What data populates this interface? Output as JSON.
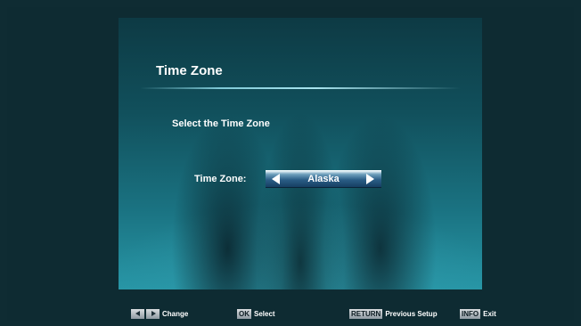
{
  "screen": {
    "title": "Time Zone",
    "instruction": "Select the Time Zone",
    "field_label": "Time Zone:",
    "selected_value": "Alaska"
  },
  "footer": {
    "change_label": "Change",
    "ok_key": "OK",
    "ok_label": "Select",
    "return_key": "RETURN",
    "return_label": "Previous Setup",
    "info_key": "INFO",
    "info_label": "Exit"
  },
  "colors": {
    "panel_top": "#0d3a44",
    "panel_bottom": "#2796a6",
    "selector_blue": "#2a5d86"
  },
  "icons": [
    "arrow-left-icon",
    "arrow-right-icon"
  ]
}
